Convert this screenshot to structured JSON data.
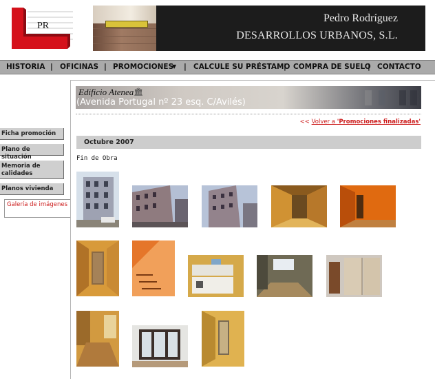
{
  "header": {
    "logo_letters": "PR",
    "name": "Pedro Rodríguez",
    "company": "DESARROLLOS URBANOS, S.L."
  },
  "nav": {
    "items": [
      "HISTORIA",
      "OFICINAS",
      "PROMOCIONES",
      "CALCULE SU PRÉSTAMO",
      "COMPRA DE SUELO",
      "CONTACTO"
    ],
    "separator": "|"
  },
  "sidebar": {
    "items": [
      "Ficha promoción",
      "Plano de situación",
      "Memoria de calidades",
      "Planos vivienda"
    ],
    "active": "Galería de imágenes"
  },
  "banner": {
    "building": "Edificio Atenea",
    "address": "(Avenida Portugal nº 23 esq. C/Avilés)"
  },
  "content": {
    "back_prefix": "<<",
    "back_link": "Volver a ",
    "back_target": "'Promociones finalizadas'",
    "month": "Octubre 2007",
    "status": "Fin de Obra"
  },
  "gallery": {
    "photos": [
      {
        "scene": "facade-tall"
      },
      {
        "scene": "facade-street"
      },
      {
        "scene": "facade-corner"
      },
      {
        "scene": "hallway-warm"
      },
      {
        "scene": "orange-room"
      },
      {
        "scene": "door-corridor"
      },
      {
        "scene": "orange-stairs"
      },
      {
        "scene": "kitchen"
      },
      {
        "scene": "room-window"
      },
      {
        "scene": "wardrobe"
      },
      {
        "scene": "wooden-floor-room"
      },
      {
        "scene": "bay-window"
      },
      {
        "scene": "yellow-corridor"
      }
    ]
  },
  "colors": {
    "accent": "#cc1b1b",
    "nav_bg": "#aaaaaa",
    "sidebar_bg": "#cfcfcf"
  }
}
